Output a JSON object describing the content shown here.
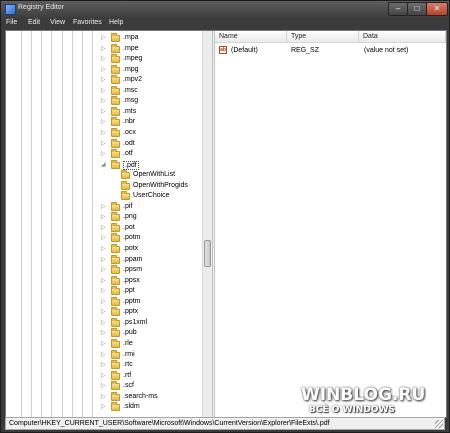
{
  "window": {
    "title": "Registry Editor",
    "icon": "registry-editor-icon"
  },
  "caption_buttons": {
    "minimize": "–",
    "maximize": "□",
    "close": "✕"
  },
  "menu": [
    "File",
    "Edit",
    "View",
    "Favorites",
    "Help"
  ],
  "tree": {
    "items": [
      {
        "label": ".mpa",
        "indent": 0,
        "toggle": "▷"
      },
      {
        "label": ".mpe",
        "indent": 0,
        "toggle": "▷"
      },
      {
        "label": ".mpeg",
        "indent": 0,
        "toggle": "▷"
      },
      {
        "label": ".mpg",
        "indent": 0,
        "toggle": "▷"
      },
      {
        "label": ".mpv2",
        "indent": 0,
        "toggle": "▷"
      },
      {
        "label": ".msc",
        "indent": 0,
        "toggle": "▷"
      },
      {
        "label": ".msg",
        "indent": 0,
        "toggle": "▷"
      },
      {
        "label": ".mts",
        "indent": 0,
        "toggle": "▷"
      },
      {
        "label": ".nbr",
        "indent": 0,
        "toggle": "▷"
      },
      {
        "label": ".ocx",
        "indent": 0,
        "toggle": "▷"
      },
      {
        "label": ".odt",
        "indent": 0,
        "toggle": "▷"
      },
      {
        "label": ".otf",
        "indent": 0,
        "toggle": "▷"
      },
      {
        "label": ".pdf",
        "indent": 0,
        "toggle": "◢",
        "selected": true
      },
      {
        "label": "OpenWithList",
        "indent": 1,
        "toggle": ""
      },
      {
        "label": "OpenWithProgids",
        "indent": 1,
        "toggle": ""
      },
      {
        "label": "UserChoice",
        "indent": 1,
        "toggle": ""
      },
      {
        "label": ".pif",
        "indent": 0,
        "toggle": "▷"
      },
      {
        "label": ".png",
        "indent": 0,
        "toggle": "▷"
      },
      {
        "label": ".pot",
        "indent": 0,
        "toggle": "▷"
      },
      {
        "label": ".potm",
        "indent": 0,
        "toggle": "▷"
      },
      {
        "label": ".potx",
        "indent": 0,
        "toggle": "▷"
      },
      {
        "label": ".ppam",
        "indent": 0,
        "toggle": "▷"
      },
      {
        "label": ".ppsm",
        "indent": 0,
        "toggle": "▷"
      },
      {
        "label": ".ppsx",
        "indent": 0,
        "toggle": "▷"
      },
      {
        "label": ".ppt",
        "indent": 0,
        "toggle": "▷"
      },
      {
        "label": ".pptm",
        "indent": 0,
        "toggle": "▷"
      },
      {
        "label": ".pptx",
        "indent": 0,
        "toggle": "▷"
      },
      {
        "label": ".ps1xml",
        "indent": 0,
        "toggle": "▷"
      },
      {
        "label": ".pub",
        "indent": 0,
        "toggle": "▷"
      },
      {
        "label": ".rle",
        "indent": 0,
        "toggle": "▷"
      },
      {
        "label": ".rmi",
        "indent": 0,
        "toggle": "▷"
      },
      {
        "label": ".rtc",
        "indent": 0,
        "toggle": "▷"
      },
      {
        "label": ".rtf",
        "indent": 0,
        "toggle": "▷"
      },
      {
        "label": ".scf",
        "indent": 0,
        "toggle": "▷"
      },
      {
        "label": ".search-ms",
        "indent": 0,
        "toggle": "▷"
      },
      {
        "label": ".sldm",
        "indent": 0,
        "toggle": "▷"
      }
    ]
  },
  "columns": {
    "name": "Name",
    "type": "Type",
    "data": "Data"
  },
  "values": [
    {
      "name": "(Default)",
      "type": "REG_SZ",
      "data": "(value not set)",
      "icon": "string-value-icon"
    }
  ],
  "status": "Computer\\HKEY_CURRENT_USER\\Software\\Microsoft\\Windows\\CurrentVersion\\Explorer\\FileExts\\.pdf",
  "watermark": {
    "title": "WINBLOG.RU",
    "subtitle": "ВСЁ О WINDOWS"
  },
  "colors": {
    "folder": "#e6b942",
    "close_button": "#b8412a"
  }
}
